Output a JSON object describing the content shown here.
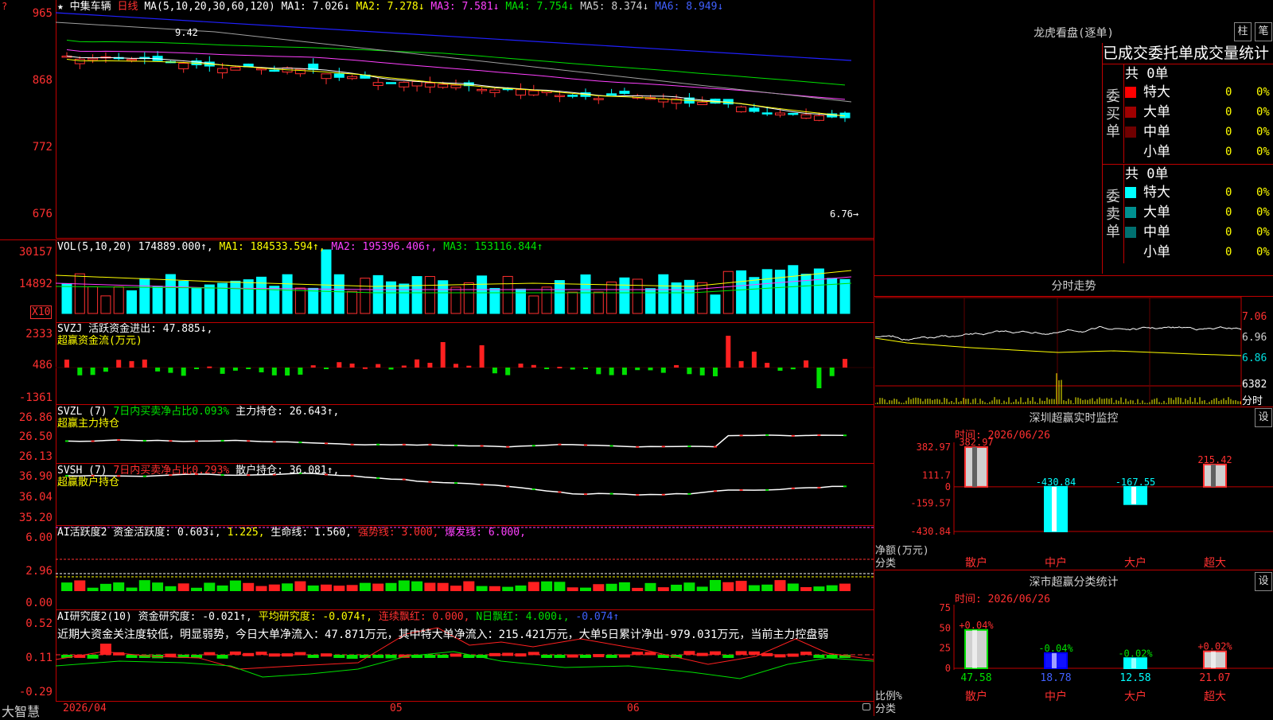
{
  "kline": {
    "stock_name": "中集车辆",
    "period": "日线",
    "ma_label": "MA(5,10,20,30,60,120)",
    "ma1": "MA1: 7.026↓",
    "ma2": "MA2: 7.278↓",
    "ma3": "MA3: 7.581↓",
    "ma4": "MA4: 7.754↓",
    "ma5": "MA5: 8.374↓",
    "ma6": "MA6: 8.949↓",
    "y_ticks": [
      "965",
      "868",
      "772",
      "676"
    ],
    "high_marker": "9.42",
    "low_marker": "6.76→",
    "star": "★"
  },
  "vol": {
    "label": "VOL(5,10,20)",
    "value": "174889.000↑,",
    "ma1": "MA1: 184533.594↑,",
    "ma2": "MA2: 195396.406↑,",
    "ma3": "MA3: 153116.844↑",
    "y_ticks": [
      "30157",
      "14892"
    ],
    "unit": "X10"
  },
  "svzj": {
    "label": "SVZJ  活跃资金进出: 47.885↓,",
    "sub": "超赢资金流(万元)",
    "y_ticks": [
      "2333",
      "486",
      "-1361"
    ]
  },
  "svzl": {
    "label_a": "SVZL  (7)",
    "label_b": "7日内买卖净占比0.093%",
    "label_c": "主力持仓: 26.643↑,",
    "sub": "超赢主力持仓",
    "y_ticks": [
      "26.86",
      "26.50",
      "26.13"
    ]
  },
  "svsh": {
    "label_a": "SVSH  (7)",
    "label_b": "7日内买卖净占比0.293%",
    "label_c": "散户持仓: 36.081↑,",
    "sub": "超赢散户持仓",
    "y_ticks": [
      "36.90",
      "36.04",
      "35.20"
    ]
  },
  "ai_active": {
    "label_a": "AI活跃度2  资金活跃度: 0.603↓,",
    "label_b": "1.225,",
    "label_c": "生命线: 1.560,",
    "label_d": "强势线: 3.000,",
    "label_e": "爆发线: 6.000,",
    "y_ticks": [
      "6.00",
      "2.96",
      "0.00"
    ]
  },
  "ai_research": {
    "label_a": "AI研究度2(10)  资金研究度: -0.021↑,",
    "label_b": "平均研究度: -0.074↑,",
    "label_c": "连续飘红: 0.000,",
    "label_d": "N日飘红: 4.000↓,",
    "label_e": "-0.074↑",
    "comment": "近期大资金关注度较低，明显弱势，今日大单净流入：47.871万元，其中特大单净流入：215.421万元，大单5日累计净出-979.031万元，当前主力控盘弱",
    "y_ticks": [
      "0.52",
      "0.11",
      "-0.29"
    ]
  },
  "bottom": {
    "logo": "大智慧",
    "dates": [
      "2026/04",
      "05",
      "06"
    ]
  },
  "dragon": {
    "title": "龙虎看盘(逐单)",
    "btn_a": "柱",
    "btn_b": "笔",
    "subtitle": "已成交委托单成交量统计",
    "buy_label": "委买单",
    "sell_label": "委卖单",
    "buy_total": "共 0单",
    "sell_total": "共 0单",
    "buy_rows": [
      {
        "name": "特大",
        "count": "0",
        "pct": "0%",
        "color": "#ff0000"
      },
      {
        "name": "大单",
        "count": "0",
        "pct": "0%",
        "color": "#a00000"
      },
      {
        "name": "中单",
        "count": "0",
        "pct": "0%",
        "color": "#700000"
      },
      {
        "name": "小单",
        "count": "0",
        "pct": "0%",
        "color": "#000000"
      }
    ],
    "sell_rows": [
      {
        "name": "特大",
        "count": "0",
        "pct": "0%",
        "color": "#00ffff"
      },
      {
        "name": "大单",
        "count": "0",
        "pct": "0%",
        "color": "#009090"
      },
      {
        "name": "中单",
        "count": "0",
        "pct": "0%",
        "color": "#007070"
      },
      {
        "name": "小单",
        "count": "0",
        "pct": "0%",
        "color": "#000000"
      }
    ]
  },
  "intraday": {
    "title": "分时走势",
    "y_ticks": [
      "7.06",
      "6.96",
      "6.86"
    ],
    "vol_top": "6382",
    "vol_label": "分时"
  },
  "monitor": {
    "title": "深圳超赢实时监控",
    "btn": "设",
    "time": "时间: 2026/06/26",
    "y_ticks": [
      "382.97",
      "111.7",
      "0",
      "-159.57",
      "-430.84"
    ],
    "unit_a": "净额(万元)",
    "unit_b": "分类",
    "categories": [
      "散户",
      "中户",
      "大户",
      "超大"
    ],
    "values": [
      382.97,
      -430.84,
      -167.55,
      215.42
    ],
    "value_labels": [
      "382.97",
      "-430.84",
      "-167.55",
      "215.42"
    ]
  },
  "classify": {
    "title": "深市超赢分类统计",
    "btn": "设",
    "time": "时间: 2026/06/26",
    "y_ticks": [
      "75",
      "50",
      "25",
      "0"
    ],
    "unit_a": "比例%",
    "unit_b": "分类",
    "categories": [
      "散户",
      "中户",
      "大户",
      "超大"
    ],
    "values": [
      47.58,
      18.78,
      12.58,
      21.07
    ],
    "change_labels": [
      "+0.04%",
      "-0.04%",
      "-0.02%",
      "+0.02%"
    ]
  },
  "chart_data": [
    {
      "type": "bar",
      "title": "深圳超赢实时监控",
      "ylabel": "净额(万元)",
      "categories": [
        "散户",
        "中户",
        "大户",
        "超大"
      ],
      "values": [
        382.97,
        -430.84,
        -167.55,
        215.42
      ],
      "ylim": [
        -430.84,
        382.97
      ]
    },
    {
      "type": "bar",
      "title": "深市超赢分类统计",
      "ylabel": "比例%",
      "categories": [
        "散户",
        "中户",
        "大户",
        "超大"
      ],
      "values": [
        47.58,
        18.78,
        12.58,
        21.07
      ],
      "ylim": [
        0,
        75
      ]
    }
  ]
}
